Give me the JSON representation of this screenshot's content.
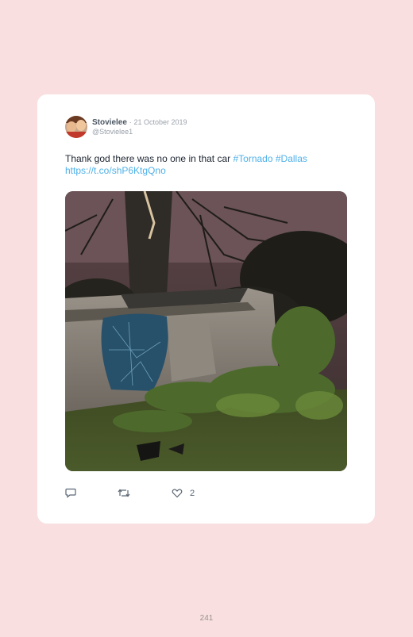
{
  "tweet": {
    "display_name": "Stovielee",
    "separator": "·",
    "date": "21 October 2019",
    "handle": "@Stovielee1",
    "text": "Thank god there was no one in that car ",
    "hashtags": [
      "#Tornado",
      "#Dallas"
    ],
    "link": "https://t.co/shP6KtgQno",
    "likes": "2",
    "media": {
      "description": "overturned-car-in-storm-debris"
    },
    "icons": {
      "reply": "reply-icon",
      "retweet": "retweet-icon",
      "like": "heart-icon"
    }
  },
  "colors": {
    "background": "#f9dfdf",
    "link": "#4fb0e8",
    "card": "#ffffff"
  },
  "page": {
    "number": "241"
  }
}
